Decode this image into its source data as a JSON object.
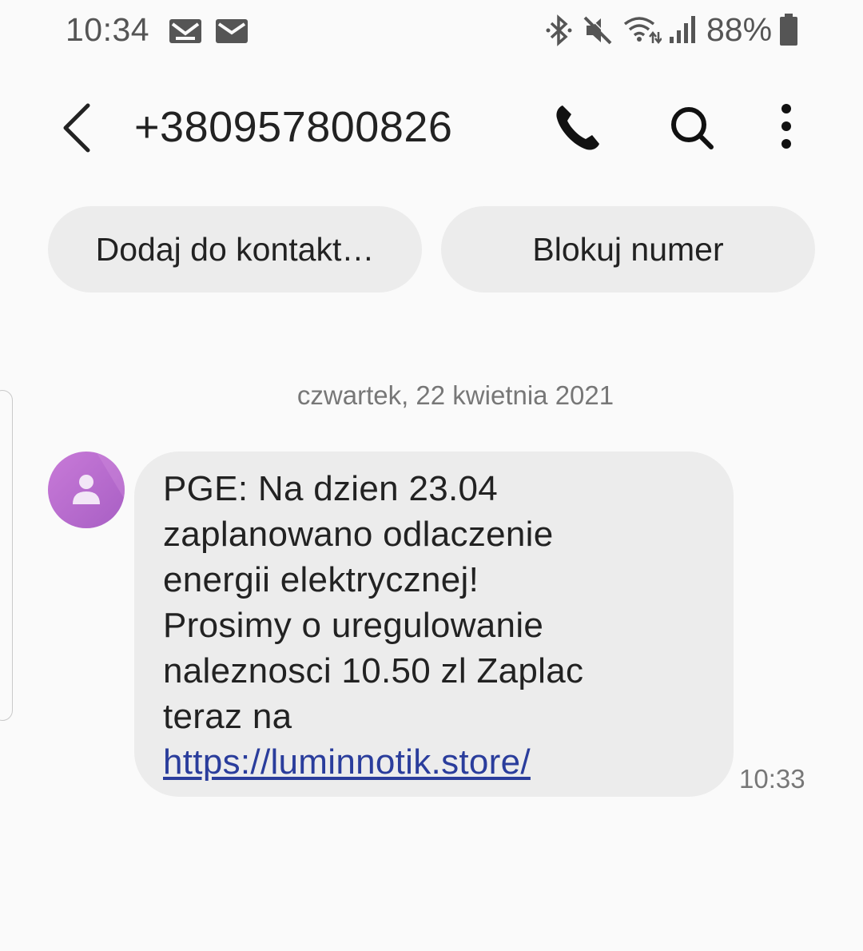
{
  "status_bar": {
    "time": "10:34",
    "battery_percent": "88%",
    "icons": [
      "gmail-icon",
      "mail-icon",
      "bluetooth-icon",
      "mute-icon",
      "wifi-icon",
      "signal-icon",
      "battery-icon"
    ]
  },
  "header": {
    "contact_number": "+380957800826",
    "icons": [
      "back-arrow-icon",
      "phone-icon",
      "search-icon",
      "more-options-icon"
    ]
  },
  "chips": {
    "add_contact": "Dodaj do kontakt…",
    "block_number": "Blokuj numer"
  },
  "conversation": {
    "date": "czwartek, 22 kwietnia 2021",
    "message": {
      "lines": [
        "PGE: Na dzien 23.04",
        "zaplanowano odlaczenie",
        "energii elektrycznej!",
        "Prosimy o uregulowanie",
        "naleznosci 10.50 zl Zaplac",
        "teraz na"
      ],
      "link": "https://luminnotik.store/",
      "time": "10:33"
    }
  },
  "colors": {
    "background": "#fafafa",
    "bubble": "#ececec",
    "link": "#2a3d9c",
    "avatar": "#b96bd0"
  }
}
